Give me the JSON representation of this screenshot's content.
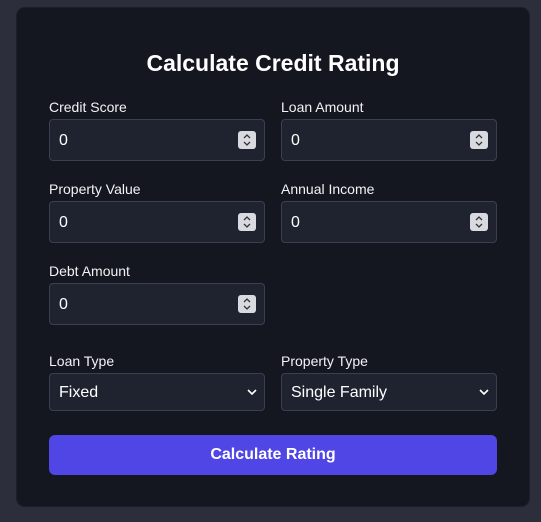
{
  "form": {
    "title": "Calculate Credit Rating",
    "fields": {
      "credit_score": {
        "label": "Credit Score",
        "value": "0"
      },
      "loan_amount": {
        "label": "Loan Amount",
        "value": "0"
      },
      "property_value": {
        "label": "Property Value",
        "value": "0"
      },
      "annual_income": {
        "label": "Annual Income",
        "value": "0"
      },
      "debt_amount": {
        "label": "Debt Amount",
        "value": "0"
      }
    },
    "selects": {
      "loan_type": {
        "label": "Loan Type",
        "value": "Fixed"
      },
      "property_type": {
        "label": "Property Type",
        "value": "Single Family"
      }
    },
    "submit_label": "Calculate Rating"
  },
  "colors": {
    "background": "#2c2f3b",
    "card": "#141620",
    "input_bg": "#1f2330",
    "input_border": "#3b4050",
    "accent": "#4f46e5"
  },
  "icons": {
    "stepper": "stepper-arrows-icon",
    "dropdown": "chevron-down-icon"
  }
}
